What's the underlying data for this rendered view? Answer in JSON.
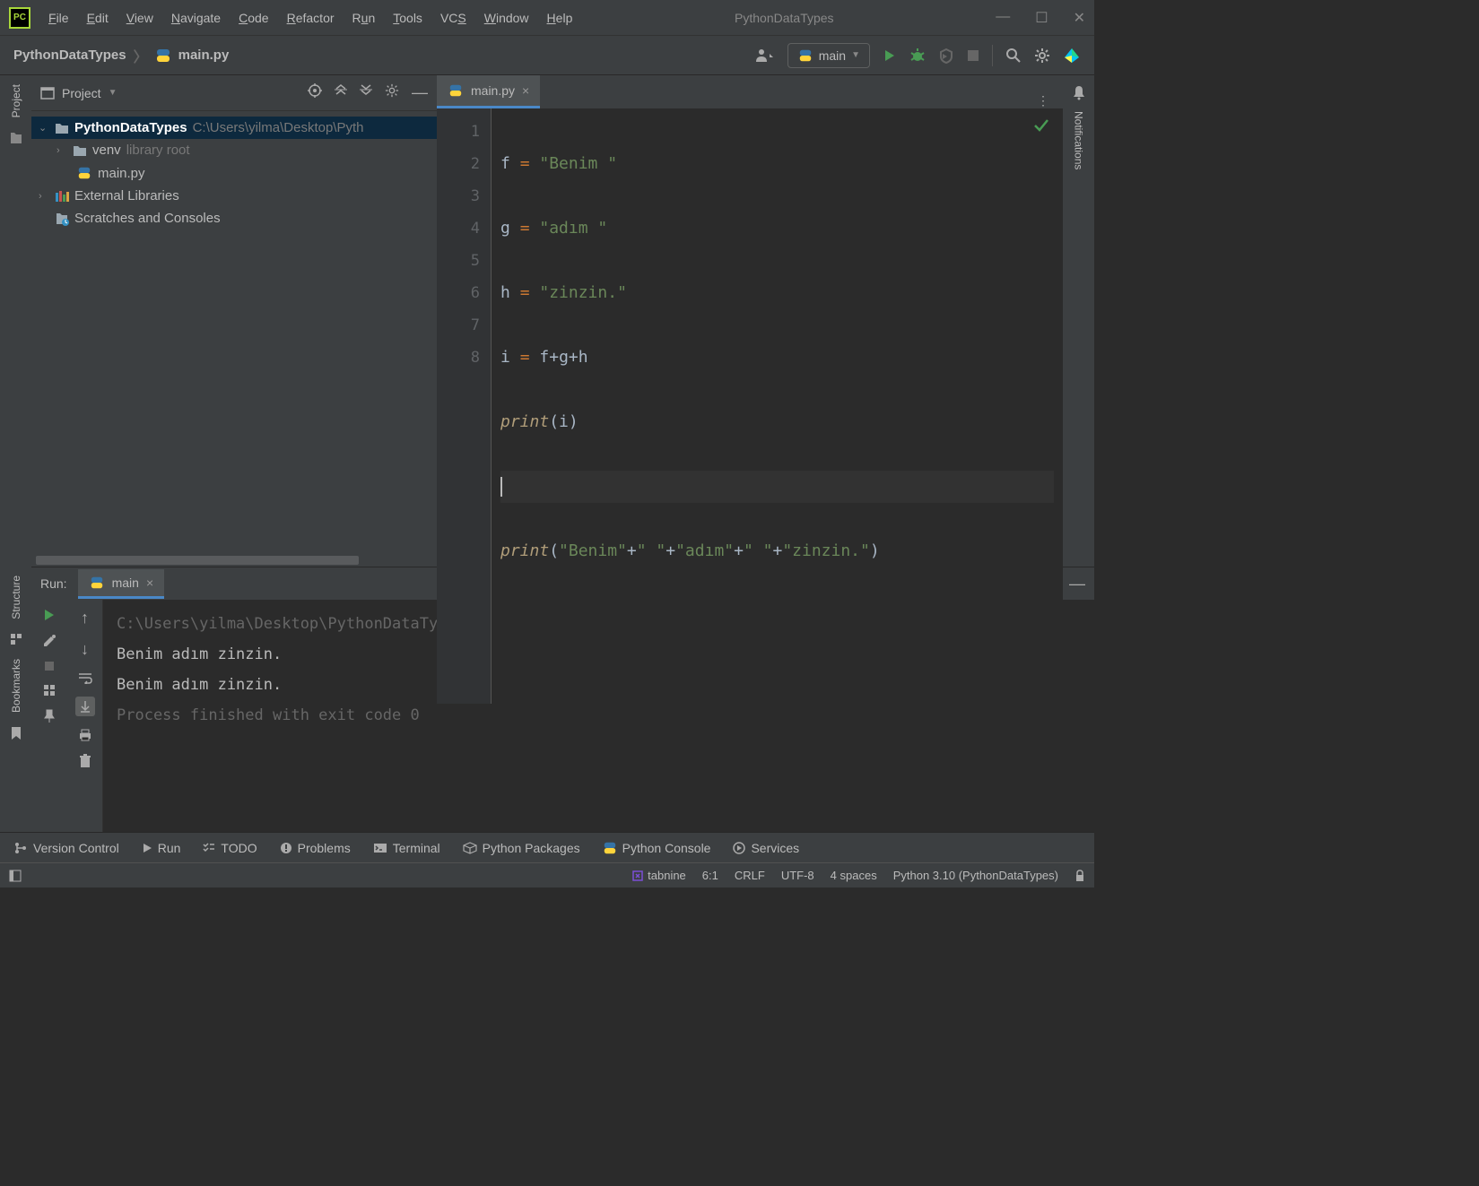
{
  "app": {
    "icon_text": "PC",
    "title": "PythonDataTypes"
  },
  "menu": [
    "File",
    "Edit",
    "View",
    "Navigate",
    "Code",
    "Refactor",
    "Run",
    "Tools",
    "VCS",
    "Window",
    "Help"
  ],
  "breadcrumb": {
    "project": "PythonDataTypes",
    "file": "main.py"
  },
  "run_config": {
    "selected": "main"
  },
  "project_panel": {
    "title": "Project",
    "root": {
      "name": "PythonDataTypes",
      "path": "C:\\Users\\yilma\\Desktop\\Pyth"
    },
    "items": [
      {
        "name": "venv",
        "hint": "library root",
        "type": "folder"
      },
      {
        "name": "main.py",
        "type": "python"
      }
    ],
    "external": "External Libraries",
    "scratches": "Scratches and Consoles"
  },
  "editor": {
    "tab": "main.py",
    "lines": [
      "1",
      "2",
      "3",
      "4",
      "5",
      "6",
      "7",
      "8"
    ]
  },
  "code": {
    "l1_var": "f",
    "l1_str": "\"Benim \"",
    "l2_var": "g",
    "l2_str": "\"adım \"",
    "l3_var": "h",
    "l3_str": "\"zinzin.\"",
    "l4_var": "i",
    "l4_expr_a": "f",
    "l4_expr_b": "g",
    "l4_expr_c": "h",
    "l5_func": "print",
    "l5_arg": "i",
    "l7_func": "print",
    "l7_s1": "\"Benim\"",
    "l7_s2": "\" \"",
    "l7_s3": "\"adım\"",
    "l7_s4": "\" \"",
    "l7_s5": "\"zinzin.\""
  },
  "run_panel": {
    "label": "Run:",
    "tab": "main",
    "output": [
      {
        "text": "C:\\Users\\yilma\\Desktop\\PythonDataTypes\\venv\\Scripts\\python.exe C:/",
        "dim": true
      },
      {
        "text": "Benim adım zinzin.",
        "dim": false
      },
      {
        "text": "Benim adım zinzin.",
        "dim": false
      },
      {
        "text": "",
        "dim": false
      },
      {
        "text": "Process finished with exit code 0",
        "dim": true
      }
    ]
  },
  "left_labels": {
    "project": "Project",
    "structure": "Structure",
    "bookmarks": "Bookmarks"
  },
  "right_labels": {
    "notifications": "Notifications"
  },
  "bottom_bar": {
    "version_control": "Version Control",
    "run": "Run",
    "todo": "TODO",
    "problems": "Problems",
    "terminal": "Terminal",
    "python_packages": "Python Packages",
    "python_console": "Python Console",
    "services": "Services"
  },
  "status": {
    "tabnine": "tabnine",
    "pos": "6:1",
    "line_sep": "CRLF",
    "encoding": "UTF-8",
    "indent": "4 spaces",
    "interpreter": "Python 3.10 (PythonDataTypes)"
  }
}
